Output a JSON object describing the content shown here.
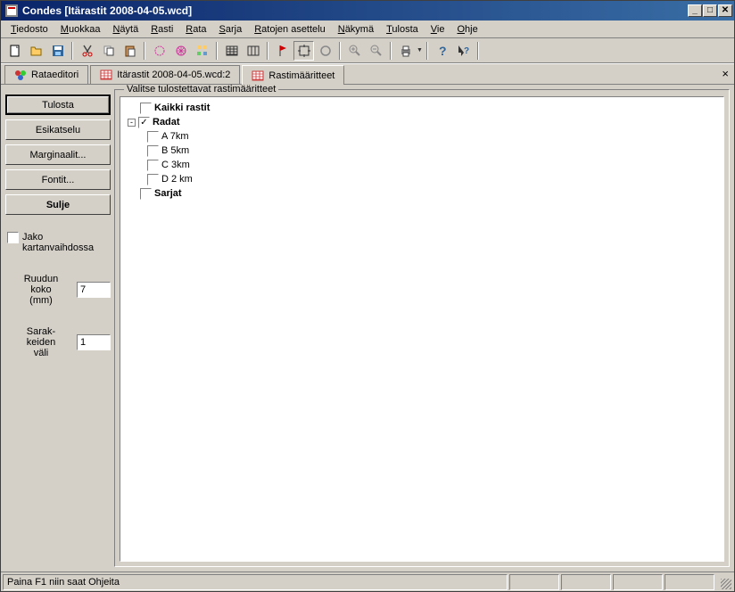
{
  "window": {
    "title": "Condes [Itärastit 2008-04-05.wcd]"
  },
  "menu": {
    "items": [
      {
        "label": "Tiedosto",
        "u": "T"
      },
      {
        "label": "Muokkaa",
        "u": "M"
      },
      {
        "label": "Näytä",
        "u": "N"
      },
      {
        "label": "Rasti",
        "u": "R"
      },
      {
        "label": "Rata",
        "u": "R"
      },
      {
        "label": "Sarja",
        "u": "S"
      },
      {
        "label": "Ratojen asettelu",
        "u": "R"
      },
      {
        "label": "Näkymä",
        "u": "N"
      },
      {
        "label": "Tulosta",
        "u": "T"
      },
      {
        "label": "Vie",
        "u": "V"
      },
      {
        "label": "Ohje",
        "u": "O"
      }
    ]
  },
  "tabs": [
    {
      "label": "Rataeditori",
      "active": false,
      "icon": "clover-icon"
    },
    {
      "label": "Itärastit 2008-04-05.wcd:2",
      "active": false,
      "icon": "grid-icon"
    },
    {
      "label": "Rastimääritteet",
      "active": true,
      "icon": "grid-icon"
    }
  ],
  "left_panel": {
    "buttons": {
      "print": "Tulosta",
      "preview": "Esikatselu",
      "margins": "Marginaalit...",
      "fonts": "Fontit...",
      "close": "Sulje"
    },
    "jako_label": "Jako kartanvaihdossa",
    "jako_checked": false,
    "grid_size_label_1": "Ruudun",
    "grid_size_label_2": "koko",
    "grid_size_label_3": "(mm)",
    "grid_size_value": "7",
    "col_gap_label_1": "Sarak-",
    "col_gap_label_2": "keiden",
    "col_gap_label_3": "väli",
    "col_gap_value": "1"
  },
  "fieldset": {
    "label": "Valitse tulostettavat rastimääritteet"
  },
  "tree": [
    {
      "level": 0,
      "expander": null,
      "checked": false,
      "label": "Kaikki rastit",
      "bold": true
    },
    {
      "level": 0,
      "expander": "-",
      "checked": true,
      "label": "Radat",
      "bold": true
    },
    {
      "level": 1,
      "expander": null,
      "checked": false,
      "label": "A 7km",
      "bold": false
    },
    {
      "level": 1,
      "expander": null,
      "checked": false,
      "label": "B 5km",
      "bold": false
    },
    {
      "level": 1,
      "expander": null,
      "checked": false,
      "label": "C 3km",
      "bold": false
    },
    {
      "level": 1,
      "expander": null,
      "checked": false,
      "label": "D 2 km",
      "bold": false
    },
    {
      "level": 0,
      "expander": null,
      "checked": false,
      "label": "Sarjat",
      "bold": true
    }
  ],
  "status": {
    "text": "Paina F1 niin saat Ohjeita"
  }
}
